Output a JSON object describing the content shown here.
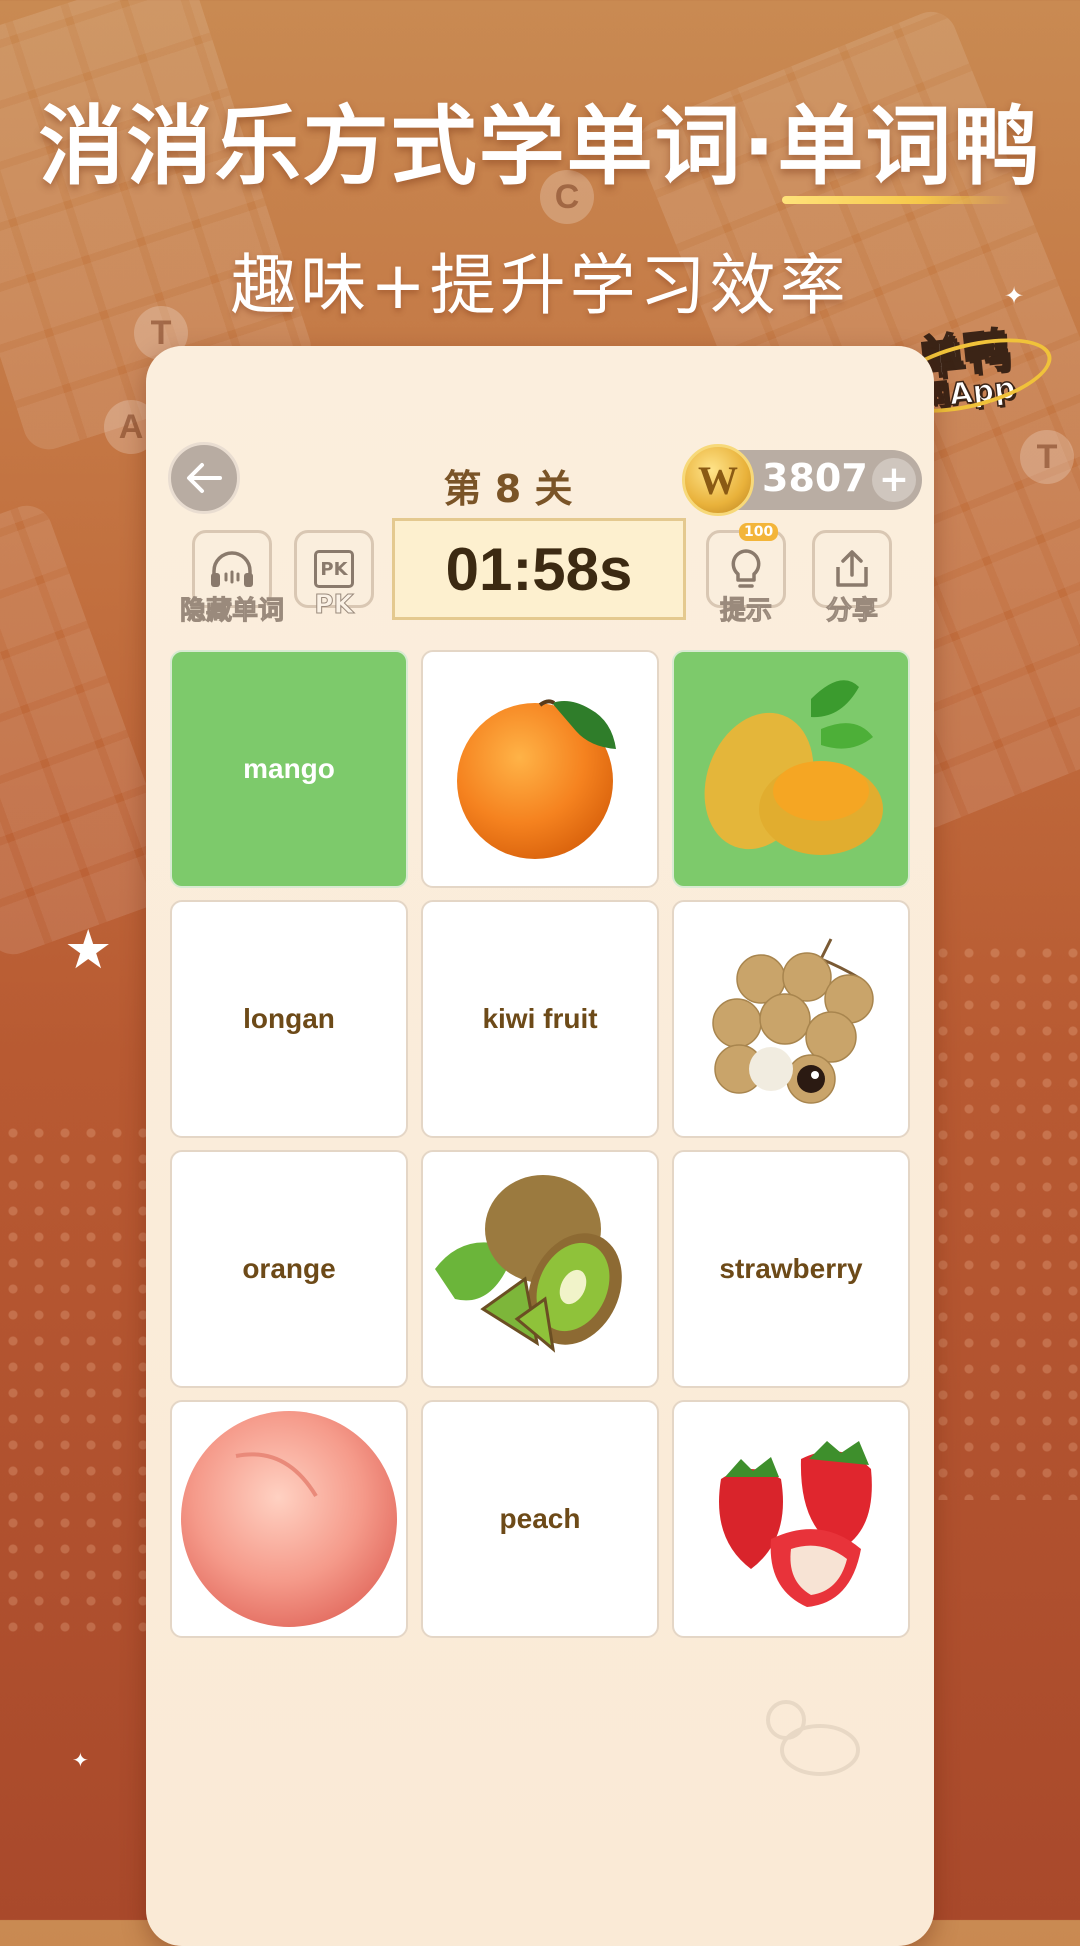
{
  "banner": {
    "headline": "消消乐方式学单词·单词鸭",
    "subtitle": "趣味+提升学习效率"
  },
  "logo": {
    "main": "单鸭",
    "sub": "词App"
  },
  "header": {
    "level": "第 8 关",
    "coins": "3807",
    "coin_symbol": "W",
    "add_symbol": "+"
  },
  "tools": [
    {
      "label": "隐藏单词",
      "icon": "headphones-icon"
    },
    {
      "label": "PK",
      "icon": "pk-icon",
      "icon_text": "PK"
    },
    {
      "label": "提示",
      "icon": "lightbulb-icon",
      "badge": "100"
    },
    {
      "label": "分享",
      "icon": "share-icon"
    }
  ],
  "timer": "01:58s",
  "cards": [
    {
      "type": "word",
      "text": "mango",
      "state": "matched"
    },
    {
      "type": "image",
      "fruit": "orange"
    },
    {
      "type": "image",
      "fruit": "mango",
      "state": "matched"
    },
    {
      "type": "word",
      "text": "longan"
    },
    {
      "type": "word",
      "text": "kiwi fruit"
    },
    {
      "type": "image",
      "fruit": "longan"
    },
    {
      "type": "word",
      "text": "orange"
    },
    {
      "type": "image",
      "fruit": "kiwi"
    },
    {
      "type": "word",
      "text": "strawberry"
    },
    {
      "type": "image",
      "fruit": "peach"
    },
    {
      "type": "word",
      "text": "peach"
    },
    {
      "type": "image",
      "fruit": "strawberry"
    }
  ],
  "colors": {
    "matched_green": "#7dca6b",
    "word_brown": "#6d4a18",
    "background_orange": "#c2703f"
  }
}
